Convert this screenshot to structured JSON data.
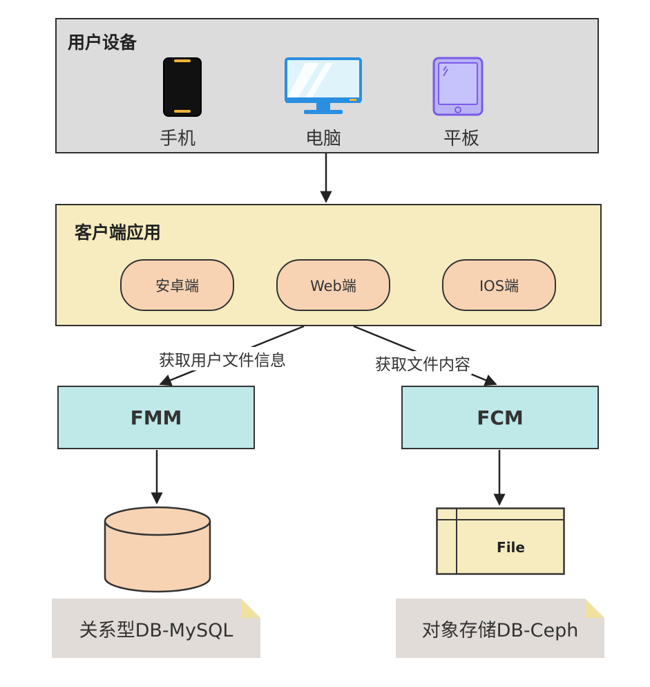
{
  "devices_panel": {
    "title": "用户设备",
    "devices": [
      {
        "label": "手机",
        "icon": "phone-icon"
      },
      {
        "label": "电脑",
        "icon": "monitor-icon"
      },
      {
        "label": "平板",
        "icon": "tablet-icon"
      }
    ]
  },
  "clients_panel": {
    "title": "客户端应用",
    "clients": [
      "安卓端",
      "Web端",
      "IOS端"
    ]
  },
  "edges": {
    "left_label": "获取用户文件信息",
    "right_label": "获取文件内容"
  },
  "services": {
    "fmm": "FMM",
    "fcm": "FCM"
  },
  "storage": {
    "file_label": "File",
    "mysql_note": "关系型DB-MySQL",
    "ceph_note": "对象存储DB-Ceph"
  },
  "colors": {
    "devices_bg": "#dcdcdc",
    "clients_bg": "#f6ecbf",
    "pill_bg": "#f7d3b4",
    "service_bg": "#bfe9e8",
    "note_bg": "#e1dcd8",
    "file_bg": "#f6ecbf"
  }
}
